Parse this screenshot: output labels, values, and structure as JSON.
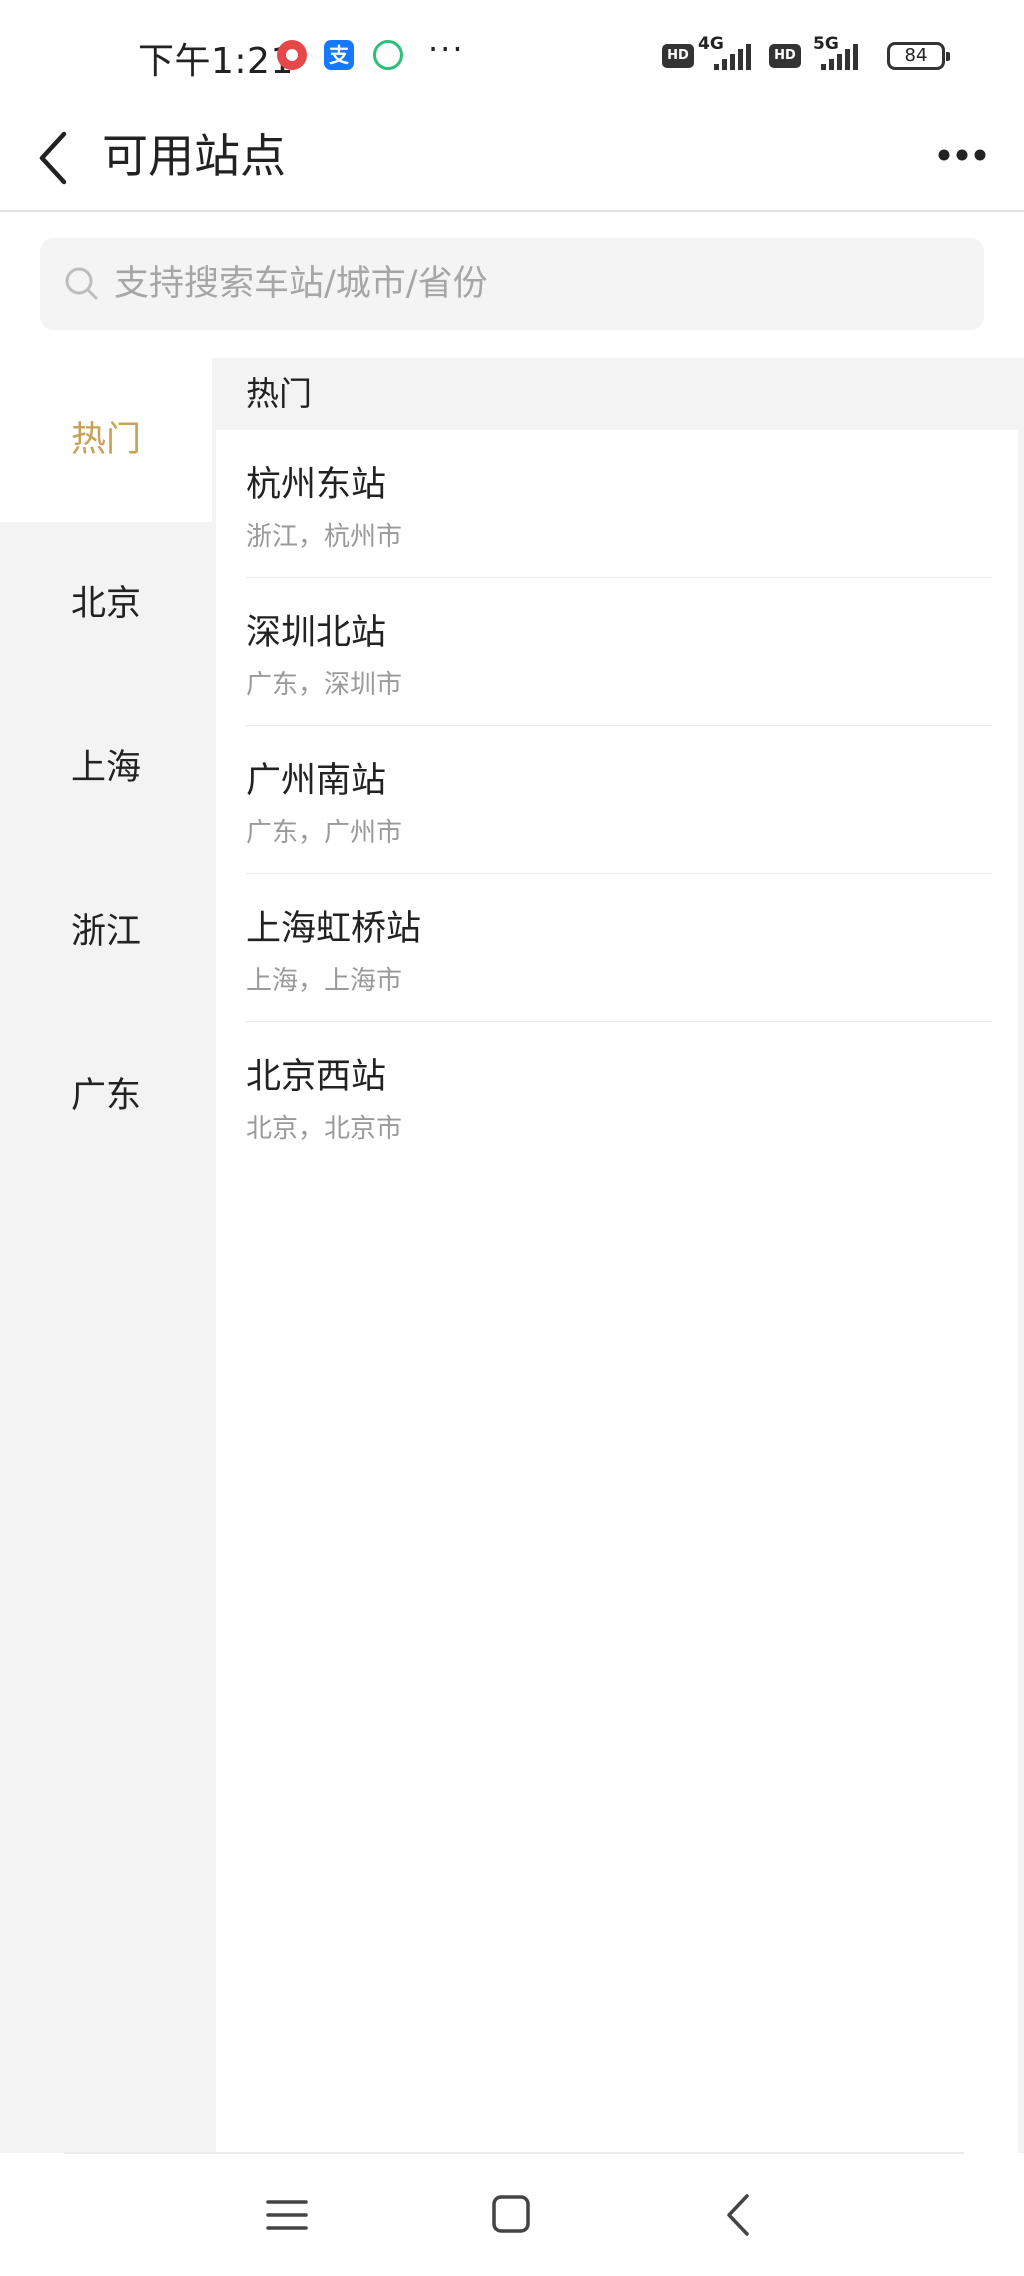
{
  "status_bar": {
    "time": "下午1:21",
    "more_glyph": "···",
    "alipay_glyph": "支",
    "hd1": "HD",
    "net1": "4G",
    "hd2": "HD",
    "net2": "5G",
    "battery": "84"
  },
  "header": {
    "title": "可用站点",
    "back_icon": "chevron-left-icon",
    "more_icon": "more-dots-icon"
  },
  "search": {
    "placeholder": "支持搜索车站/城市/省份",
    "value": ""
  },
  "sidebar": {
    "items": [
      {
        "label": "热门",
        "active": true
      },
      {
        "label": "北京"
      },
      {
        "label": "上海"
      },
      {
        "label": "浙江"
      },
      {
        "label": "广东"
      }
    ]
  },
  "main": {
    "section_title": "热门",
    "stations": [
      {
        "name": "杭州东站",
        "region": "浙江，杭州市"
      },
      {
        "name": "深圳北站",
        "region": "广东，深圳市"
      },
      {
        "name": "广州南站",
        "region": "广东，广州市"
      },
      {
        "name": "上海虹桥站",
        "region": "上海，上海市"
      },
      {
        "name": "北京西站",
        "region": "北京，北京市"
      }
    ]
  },
  "navbar": {
    "menu_icon": "menu-icon",
    "home_icon": "home-icon",
    "back_icon": "back-icon"
  },
  "colors": {
    "accent": "#c9a156",
    "sidebar_bg": "#f3f3f3",
    "secondary_text": "#9a9a9a"
  }
}
